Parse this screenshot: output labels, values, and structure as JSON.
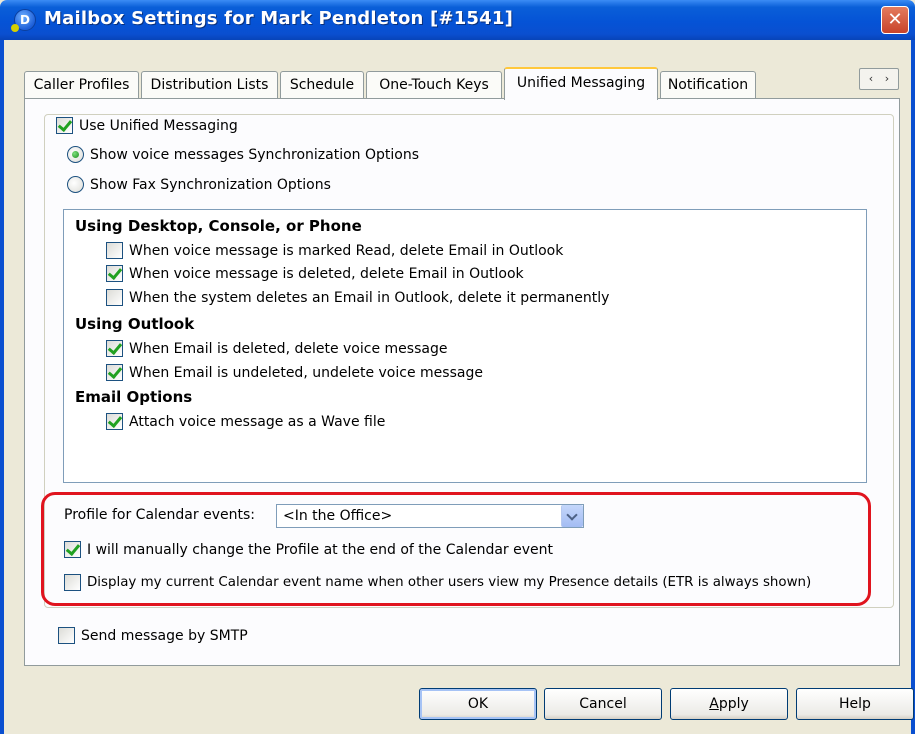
{
  "window": {
    "title": "Mailbox Settings for Mark Pendleton [#1541]",
    "icon_letter": "D",
    "close_glyph": "✕"
  },
  "tabs": [
    {
      "label": "Caller Profiles"
    },
    {
      "label": "Distribution Lists"
    },
    {
      "label": "Schedule"
    },
    {
      "label": "One-Touch Keys"
    },
    {
      "label": "Unified Messaging",
      "active": true
    },
    {
      "label": "Notification"
    }
  ],
  "tab_scroll": {
    "left": "‹",
    "right": "›"
  },
  "unified": {
    "use_label": "Use Unified Messaging",
    "use_checked": true,
    "radio_voice": "Show voice messages Synchronization Options",
    "radio_fax": "Show Fax Synchronization Options",
    "selected_radio": "voice"
  },
  "sync": {
    "desktop_heading": "Using Desktop, Console, or Phone",
    "desktop_items": [
      {
        "label": "When voice message is marked Read, delete Email in Outlook",
        "checked": false
      },
      {
        "label": "When voice message is deleted, delete Email in Outlook",
        "checked": true
      },
      {
        "label": "When the system deletes an Email in Outlook, delete it permanently",
        "checked": false
      }
    ],
    "outlook_heading": "Using Outlook",
    "outlook_items": [
      {
        "label": "When Email is deleted, delete voice message",
        "checked": true
      },
      {
        "label": "When Email is undeleted, undelete voice message",
        "checked": true
      }
    ],
    "email_heading": "Email Options",
    "email_items": [
      {
        "label": "Attach voice message as a Wave file",
        "checked": true
      }
    ]
  },
  "calendar": {
    "profile_label": "Profile for Calendar events:",
    "profile_value": "<In the Office>",
    "manual_label": "I will manually change the Profile at the end of the Calendar event",
    "manual_checked": true,
    "display_label": "Display my current Calendar event name when other users view my Presence details (ETR is always shown)",
    "display_checked": false
  },
  "smtp": {
    "label": "Send message by SMTP",
    "checked": false
  },
  "buttons": {
    "ok": "OK",
    "cancel": "Cancel",
    "apply": "Apply",
    "help": "Help"
  },
  "colors": {
    "titlebar": "#0553d6",
    "highlight": "#e0141e",
    "tab_accent": "#ffc83c"
  }
}
